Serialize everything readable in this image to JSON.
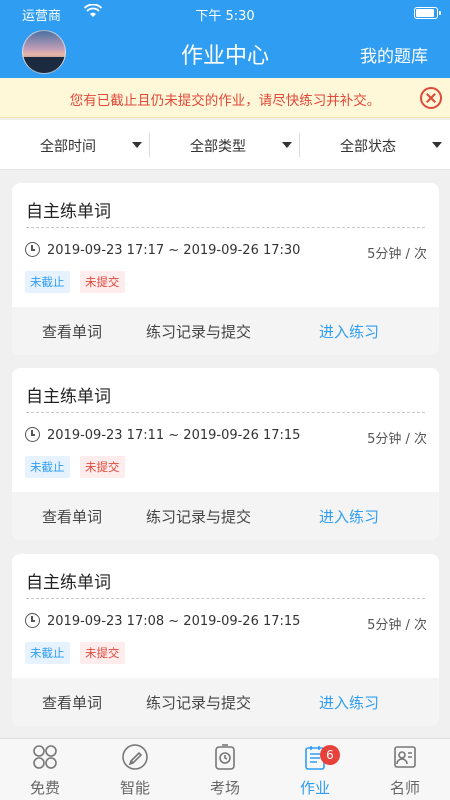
{
  "status_bar": {
    "carrier": "运营商",
    "time": "下午 5:30"
  },
  "header": {
    "title": "作业中心",
    "right_action": "我的题库"
  },
  "notice": {
    "text": "您有已截止且仍未提交的作业，请尽快练习并补交。"
  },
  "filters": [
    {
      "label": "全部时间"
    },
    {
      "label": "全部类型"
    },
    {
      "label": "全部状态"
    }
  ],
  "assignments": [
    {
      "title": "自主练单词",
      "time_range": "2019-09-23 17:17 ~ 2019-09-26 17:30",
      "duration": "5分钟 / 次",
      "badges": [
        "未截止",
        "未提交"
      ],
      "actions": [
        "查看单词",
        "练习记录与提交",
        "进入练习"
      ]
    },
    {
      "title": "自主练单词",
      "time_range": "2019-09-23 17:11 ~ 2019-09-26 17:15",
      "duration": "5分钟 / 次",
      "badges": [
        "未截止",
        "未提交"
      ],
      "actions": [
        "查看单词",
        "练习记录与提交",
        "进入练习"
      ]
    },
    {
      "title": "自主练单词",
      "time_range": "2019-09-23 17:08 ~ 2019-09-26 17:15",
      "duration": "5分钟 / 次",
      "badges": [
        "未截止",
        "未提交"
      ],
      "actions": [
        "查看单词",
        "练习记录与提交",
        "进入练习"
      ]
    }
  ],
  "tabbar": [
    {
      "label": "免费",
      "icon": "grid-icon",
      "active": false
    },
    {
      "label": "智能",
      "icon": "pencil-icon",
      "active": false
    },
    {
      "label": "考场",
      "icon": "timer-icon",
      "active": false
    },
    {
      "label": "作业",
      "icon": "notepad-icon",
      "active": true,
      "badge": "6"
    },
    {
      "label": "名师",
      "icon": "teacher-icon",
      "active": false
    }
  ],
  "colors": {
    "primary": "#2f9ef2",
    "alert": "#e0483a",
    "notice_bg": "#fff8d8"
  }
}
